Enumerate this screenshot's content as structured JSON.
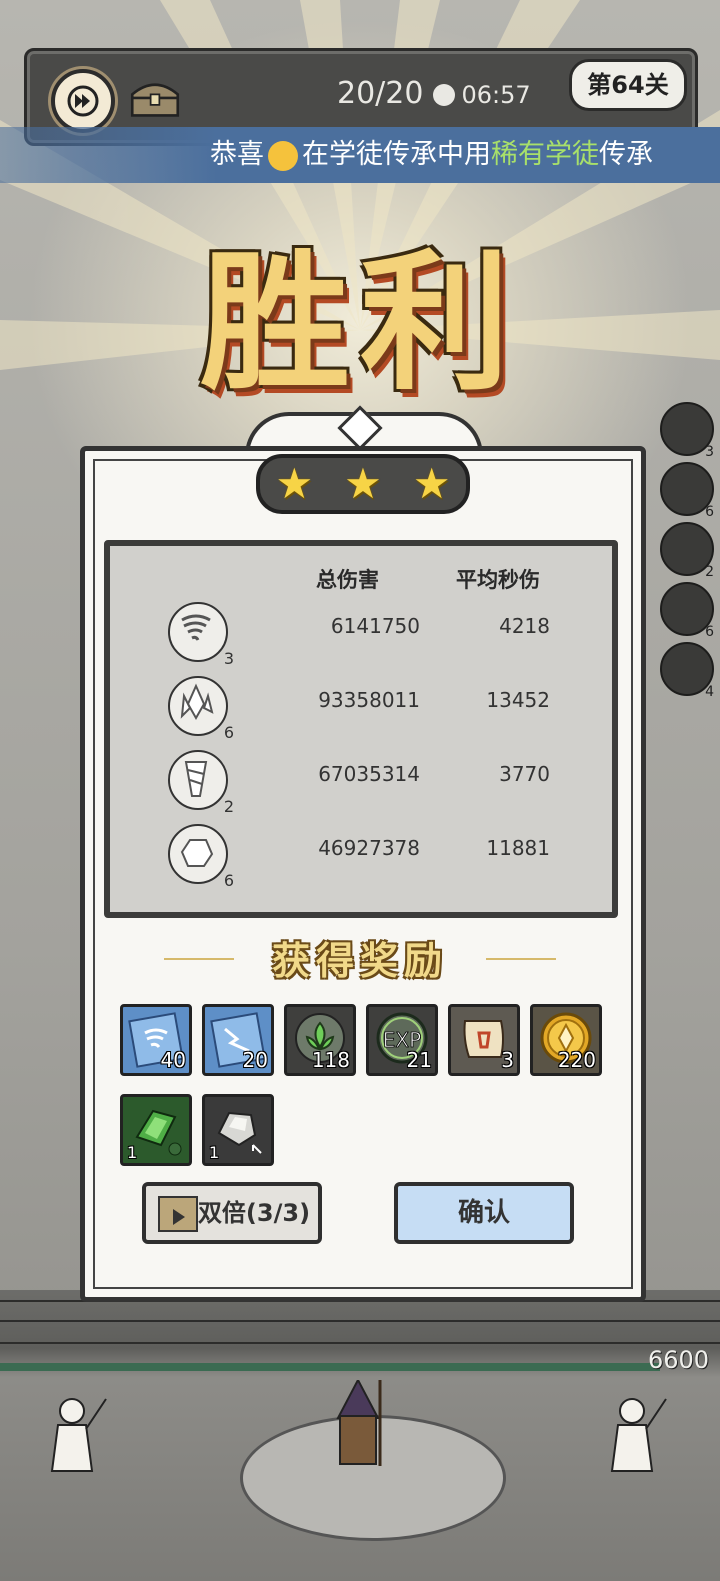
{
  "hud": {
    "wave": "20/20",
    "time": "06:57",
    "level": "第64关",
    "speed_icon": "fast-forward-icon",
    "chest_icon": "treasure-chest-icon"
  },
  "ticker": {
    "prefix": "恭喜",
    "middle": "在学徒传承中用",
    "highlight": "稀有学徒",
    "suffix": "传承"
  },
  "victory_text": "胜利",
  "stars": 3,
  "side_skills": [
    {
      "icon": "tornado-icon",
      "level": "3"
    },
    {
      "icon": "crystal-icon",
      "level": "6"
    },
    {
      "icon": "drill-icon",
      "level": "2"
    },
    {
      "icon": "rock-icon",
      "level": "6"
    },
    {
      "icon": "orb-icon",
      "level": "4"
    }
  ],
  "stats": {
    "col_total": "总伤害",
    "col_dps": "平均秒伤",
    "rows": [
      {
        "icon": "tornado-icon",
        "level": "3",
        "total": "6141750",
        "dps": "4218"
      },
      {
        "icon": "crystal-icon",
        "level": "6",
        "total": "93358011",
        "dps": "13452"
      },
      {
        "icon": "drill-icon",
        "level": "2",
        "total": "67035314",
        "dps": "3770"
      },
      {
        "icon": "rock-icon",
        "level": "6",
        "total": "46927378",
        "dps": "11881"
      }
    ]
  },
  "rewards": {
    "title": "获得奖励",
    "items": [
      {
        "icon": "tornado-book-icon",
        "count": "40"
      },
      {
        "icon": "lightning-book-icon",
        "count": "20"
      },
      {
        "icon": "leaf-emblem-icon",
        "count": "118"
      },
      {
        "icon": "exp-icon",
        "count": "21"
      },
      {
        "icon": "scroll-icon",
        "count": "3"
      },
      {
        "icon": "gold-coin-icon",
        "count": "220"
      },
      {
        "icon": "green-gem-icon",
        "count": "1"
      },
      {
        "icon": "silver-ore-icon",
        "count": "1"
      }
    ]
  },
  "buttons": {
    "double": "双倍(3/3)",
    "confirm": "确认"
  },
  "base_hp": "6600"
}
